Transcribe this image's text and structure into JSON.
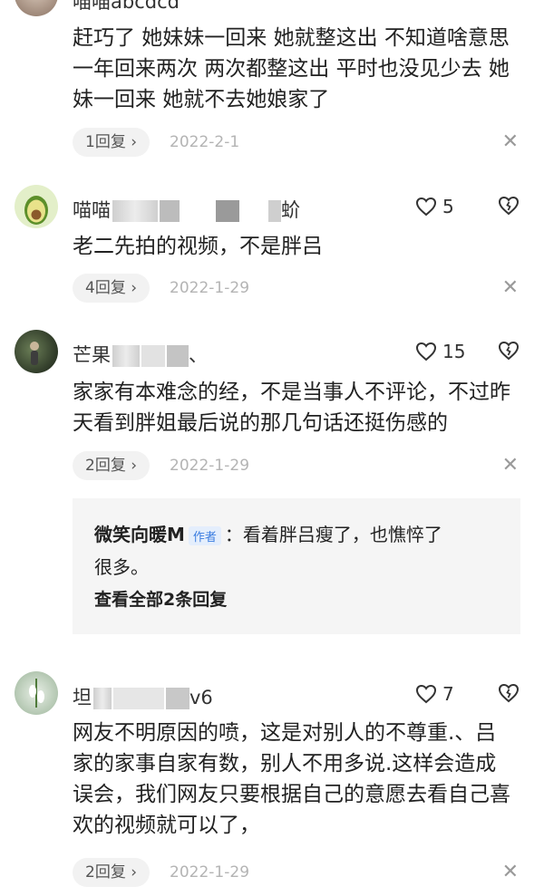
{
  "comments": [
    {
      "name": "喵喵abcdcd",
      "body": "赶巧了 她妹妹一回来 她就整这出 不知道啥意思 一年回来两次 两次都整这出 平时也没见少去 她妹一回来 她就不去她娘家了",
      "reply_label": "1回复 ›",
      "date": "2022-2-1"
    },
    {
      "name_prefix": "喵喵",
      "name_suffix": "蚧",
      "body": "老二先拍的视频，不是胖吕",
      "likes": "5",
      "reply_label": "4回复 ›",
      "date": "2022-1-29"
    },
    {
      "name_prefix": "芒果",
      "name_suffix": "、",
      "body": "家家有本难念的经，不是当事人不评论，不过昨天看到胖姐最后说的那几句话还挺伤感的",
      "likes": "15",
      "reply_label": "2回复 ›",
      "date": "2022-1-29",
      "sub_reply": {
        "author": "微笑向暖M",
        "author_tag": "作者",
        "text_first": "：看着胖吕瘦了，也憔悴了",
        "text_second": "很多。",
        "view_all": "查看全部2条回复"
      }
    },
    {
      "name_prefix": "坦",
      "name_suffix": "v6",
      "body": "网友不明原因的喷，这是对别人的不尊重.、吕家的家事自家有数，别人不用多说.这样会造成误会，我们网友只要根据自己的意愿去看自己喜欢的视频就可以了，",
      "likes": "7",
      "reply_label": "2回复 ›",
      "date": "2022-1-29"
    }
  ],
  "icons": {
    "like": "heart-outline-icon",
    "dislike": "broken-heart-outline-icon",
    "close": "close-icon"
  },
  "close_glyph": "✕"
}
